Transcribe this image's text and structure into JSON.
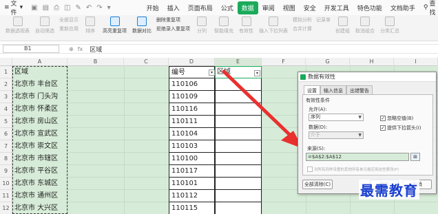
{
  "menubar": {
    "file_label": "文件",
    "tabs": [
      {
        "label": "开始"
      },
      {
        "label": "插入"
      },
      {
        "label": "页面布局"
      },
      {
        "label": "公式"
      },
      {
        "label": "数据",
        "active": true
      },
      {
        "label": "审阅"
      },
      {
        "label": "视图"
      },
      {
        "label": "安全"
      },
      {
        "label": "开发工具"
      },
      {
        "label": "特色功能"
      },
      {
        "label": "文档助手"
      }
    ],
    "search_label": "查找"
  },
  "ribbon": {
    "items": [
      {
        "label": "数据透视表"
      },
      {
        "label": "自动筛选"
      },
      {
        "label": "重新应用"
      },
      {
        "label": "排序"
      },
      {
        "label": "高亮重复项"
      },
      {
        "label": "数据对比"
      },
      {
        "label": "拒绝录入重复项"
      },
      {
        "label": "分列"
      },
      {
        "label": "智能填充"
      },
      {
        "label": "有效性"
      },
      {
        "label": "插入下拉列表"
      },
      {
        "label": "合并计算"
      },
      {
        "label": "记录单"
      },
      {
        "label": "创建组"
      },
      {
        "label": "取消组合"
      },
      {
        "label": "分类汇总"
      }
    ],
    "top_labels": {
      "all_show": "全部显示",
      "delete_dup": "删除重复项",
      "sim_analysis": "模拟分析"
    }
  },
  "formula_bar": {
    "cell_ref": "B1",
    "fx": "fx",
    "value": "区域"
  },
  "grid": {
    "columns": [
      "A",
      "B",
      "C",
      "D",
      "E",
      "F",
      "G",
      "H",
      "I"
    ],
    "rows": [
      "1",
      "2",
      "3",
      "4",
      "5",
      "6",
      "7",
      "8",
      "9",
      "10",
      "11",
      "12"
    ],
    "col_a": [
      "区域",
      "北京市 丰台区",
      "北京市 门头沟",
      "北京市 怀柔区",
      "北京市 房山区",
      "北京市 宣武区",
      "北京市 崇文区",
      "北京市 市辖区",
      "北京市 平谷区",
      "北京市 东城区",
      "北京市 通州区",
      "北京市 大兴区"
    ],
    "col_d": [
      "编号",
      "110106",
      "110109",
      "110116",
      "110111",
      "110104",
      "110103",
      "110100",
      "110117",
      "110101",
      "110112",
      "110115"
    ],
    "e1": "区域"
  },
  "dialog": {
    "title": "数据有效性",
    "tabs": [
      {
        "label": "设置",
        "active": true
      },
      {
        "label": "输入信息"
      },
      {
        "label": "出错警告"
      }
    ],
    "conditions_label": "有效性条件",
    "allow_label": "允许(A):",
    "allow_value": "序列",
    "data_label": "数据(D):",
    "data_value": "介于",
    "ignore_blank_label": "忽略空值(B)",
    "ignore_blank_checked": true,
    "dropdown_label": "提供下拉箭头(I)",
    "dropdown_checked": true,
    "source_label": "来源(S):",
    "source_value": "=$A$2:$A$12",
    "apply_all_label": "对所有同样设置的其他所有单元格应用这些更改(P)",
    "clear_all_label": "全部清除(C)",
    "ok_label": "确定",
    "cancel_label": "取消"
  },
  "watermark": "最需教育",
  "colors": {
    "accent": "#1aaa5a",
    "sheet_bg": "#d7ecd8",
    "arrow": "#e8312f",
    "watermark": "#1a3fd0"
  }
}
